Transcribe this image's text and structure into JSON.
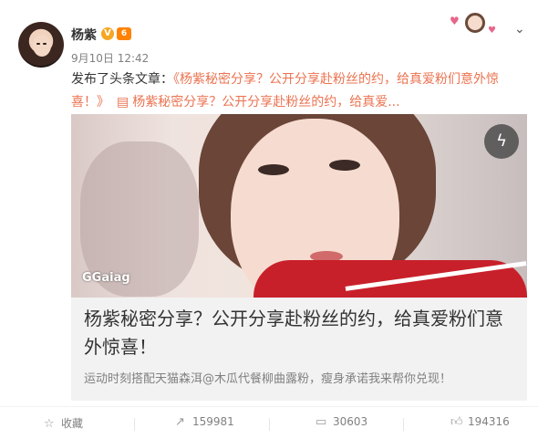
{
  "post": {
    "author": "杨紫",
    "verified_mark": "V",
    "level_mark": "6",
    "timestamp": "9月10日 12:42",
    "text_prefix": "发布了头条文章：",
    "text_link": "《杨紫秘密分享？公开分享赴粉丝的约，给真爱粉们意外惊喜！》",
    "article_ref": "杨紫秘密分享？公开分享赴粉丝的约，给真爱..."
  },
  "card": {
    "watermark": "GGaiag",
    "title": "杨紫秘密分享？公开分享赴粉丝的约，给真爱粉们意外惊喜！",
    "description": "运动时刻搭配天猫森洱@木瓜代餐柳曲露粉，瘦身承诺我来帮你兑现！"
  },
  "actions": {
    "favorite_label": "收藏",
    "repost_count": "159981",
    "comment_count": "30603",
    "like_count": "194316"
  },
  "icons": {
    "favorite": "star-icon",
    "repost": "repost-icon",
    "comment": "comment-icon",
    "like": "thumbs-up-icon",
    "menu": "chevron-down-icon",
    "article": "article-icon",
    "flash": "lightning-icon"
  },
  "colors": {
    "link": "#eb7350",
    "verified": "#f5a623",
    "muted": "#808080"
  }
}
